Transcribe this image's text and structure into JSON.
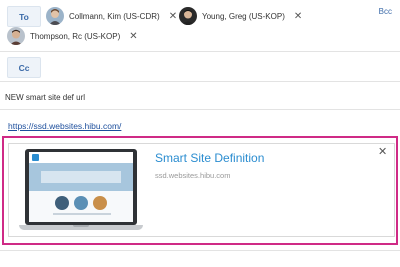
{
  "recipients": {
    "to_label": "To",
    "cc_label": "Cc",
    "bcc_label": "Bcc",
    "to": [
      {
        "name": "Collmann, Kim (US-CDR)"
      },
      {
        "name": "Young, Greg (US-KOP)"
      },
      {
        "name": "Thompson, Rc (US-KOP)"
      }
    ],
    "remove_glyph": "✕"
  },
  "subject": "NEW smart site def url",
  "body": {
    "link": "https://ssd.websites.hibu.com/"
  },
  "preview_card": {
    "title": "Smart Site Definition",
    "domain": "ssd.websites.hibu.com",
    "close_glyph": "✕"
  },
  "colors": {
    "accent": "#2b8dd0",
    "highlight_frame": "#cf2a86",
    "link": "#1c4e9c"
  }
}
